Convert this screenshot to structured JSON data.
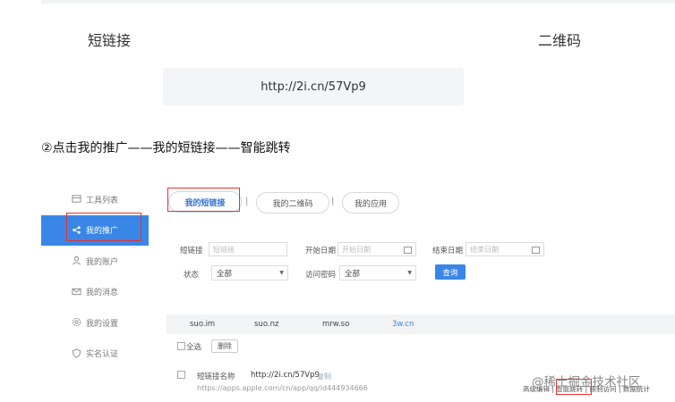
{
  "doc": {
    "header_left": "短链接",
    "header_right": "二维码",
    "url_example": "http://2i.cn/57Vp9",
    "step_text": "②点击我的推广——我的短链接——智能跳转"
  },
  "screenshot": {
    "sidebar": [
      {
        "label": "工具列表",
        "icon": "grid-icon"
      },
      {
        "label": "我的推广",
        "icon": "share-icon",
        "active": true
      },
      {
        "label": "我的账户",
        "icon": "user-icon"
      },
      {
        "label": "我的消息",
        "icon": "mail-icon"
      },
      {
        "label": "我的设置",
        "icon": "gear-icon"
      },
      {
        "label": "实名认证",
        "icon": "shield-icon"
      }
    ],
    "tabs": [
      "我的短链接",
      "我的二维码",
      "我的应用"
    ],
    "tab_separator": "|",
    "filters": {
      "short_link_label": "短链接",
      "short_link_placeholder": "短链接",
      "start_date_label": "开始日期",
      "start_date_placeholder": "开始日期",
      "end_date_label": "结束日期",
      "end_date_placeholder": "结束日期",
      "status_label": "状态",
      "status_value": "全部",
      "password_label": "访问密码",
      "password_value": "全部",
      "query_button": "查询"
    },
    "domains": [
      "suo.im",
      "suo.nz",
      "mrw.so",
      "3w.cn"
    ],
    "select_all": "全选",
    "delete_button": "删除",
    "row": {
      "name_label": "短链接名称",
      "short_url": "http://2i.cn/57Vp9",
      "copy": "复制",
      "long_url": "https://apps.apple.com/cn/app/qq/id444934666"
    },
    "actions": [
      "高级编辑",
      "智能跳转",
      "限制访问",
      "数据统计"
    ]
  },
  "watermark": "@稀土掘金技术社区",
  "colors": {
    "accent": "#3a86e6",
    "highlight": "#e8322f"
  }
}
